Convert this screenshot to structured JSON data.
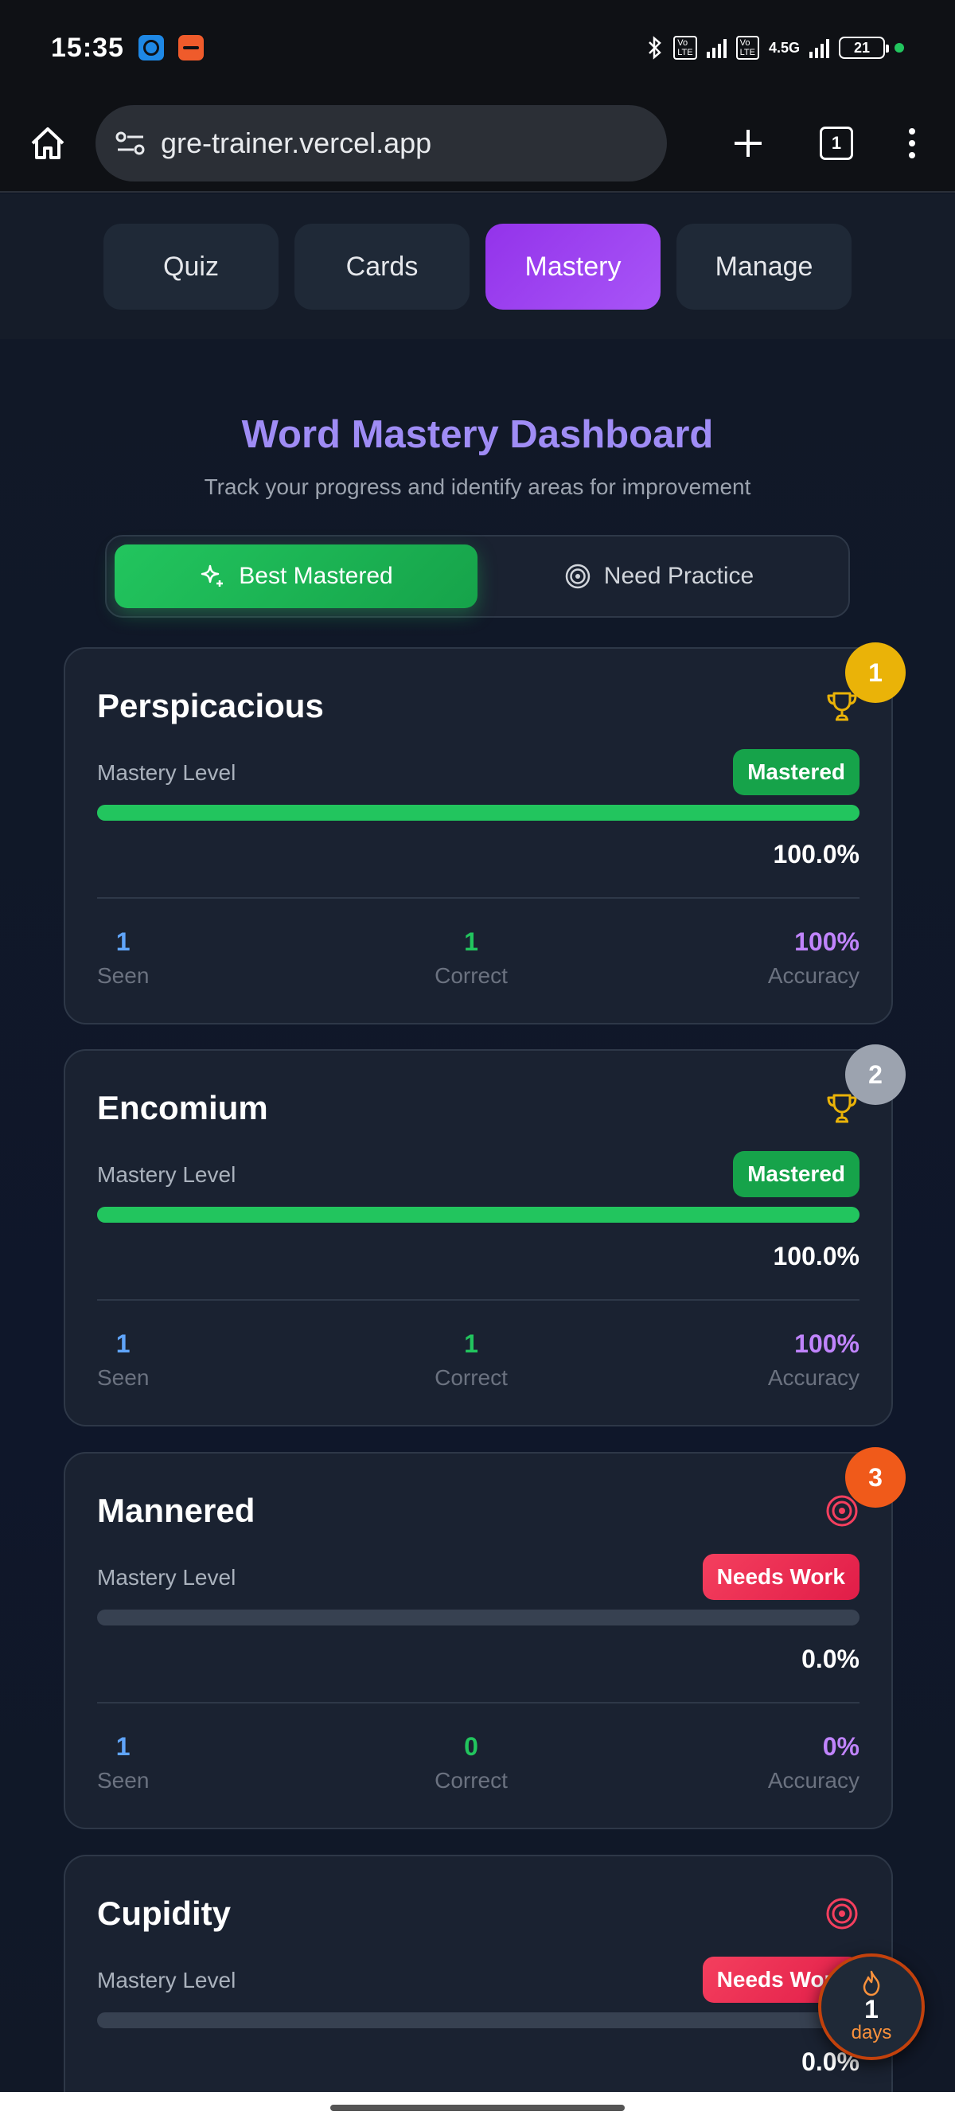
{
  "status_bar": {
    "time": "15:35",
    "network_label": "4.5G",
    "battery": "21"
  },
  "browser": {
    "url": "gre-trainer.vercel.app",
    "tab_count": "1"
  },
  "nav": {
    "tabs": [
      {
        "label": "Quiz",
        "active": false
      },
      {
        "label": "Cards",
        "active": false
      },
      {
        "label": "Mastery",
        "active": true
      },
      {
        "label": "Manage",
        "active": false
      }
    ]
  },
  "dashboard": {
    "title": "Word Mastery Dashboard",
    "subtitle": "Track your progress and identify areas for improvement",
    "filter": {
      "best_label": "Best Mastered",
      "practice_label": "Need Practice",
      "selected": "Best Mastered"
    }
  },
  "words": [
    {
      "rank": "1",
      "rank_color": "#eab308",
      "word": "Perspicacious",
      "icon": "trophy-icon",
      "mastery_label": "Mastery Level",
      "status": "Mastered",
      "mastery_percent": "100.0%",
      "mastery_fraction": 1.0,
      "seen": "1",
      "seen_label": "Seen",
      "correct": "1",
      "correct_label": "Correct",
      "accuracy": "100%",
      "accuracy_label": "Accuracy"
    },
    {
      "rank": "2",
      "rank_color": "#9ca3af",
      "word": "Encomium",
      "icon": "trophy-icon",
      "mastery_label": "Mastery Level",
      "status": "Mastered",
      "mastery_percent": "100.0%",
      "mastery_fraction": 1.0,
      "seen": "1",
      "seen_label": "Seen",
      "correct": "1",
      "correct_label": "Correct",
      "accuracy": "100%",
      "accuracy_label": "Accuracy"
    },
    {
      "rank": "3",
      "rank_color": "#f05a1a",
      "word": "Mannered",
      "icon": "target-icon",
      "mastery_label": "Mastery Level",
      "status": "Needs Work",
      "mastery_percent": "0.0%",
      "mastery_fraction": 0.0,
      "seen": "1",
      "seen_label": "Seen",
      "correct": "0",
      "correct_label": "Correct",
      "accuracy": "0%",
      "accuracy_label": "Accuracy"
    },
    {
      "word": "Cupidity",
      "icon": "target-icon",
      "mastery_label": "Mastery Level",
      "status": "Needs Work",
      "mastery_percent": "0.0%",
      "mastery_fraction": 0.0
    }
  ],
  "streak": {
    "count": "1",
    "unit": "days"
  },
  "colors": {
    "accent_purple": "#a855f7",
    "mastered_green": "#22c55e",
    "needs_work_red": "#e11d48",
    "seen_blue": "#60a5fa",
    "accuracy_purple": "#c084fc"
  }
}
